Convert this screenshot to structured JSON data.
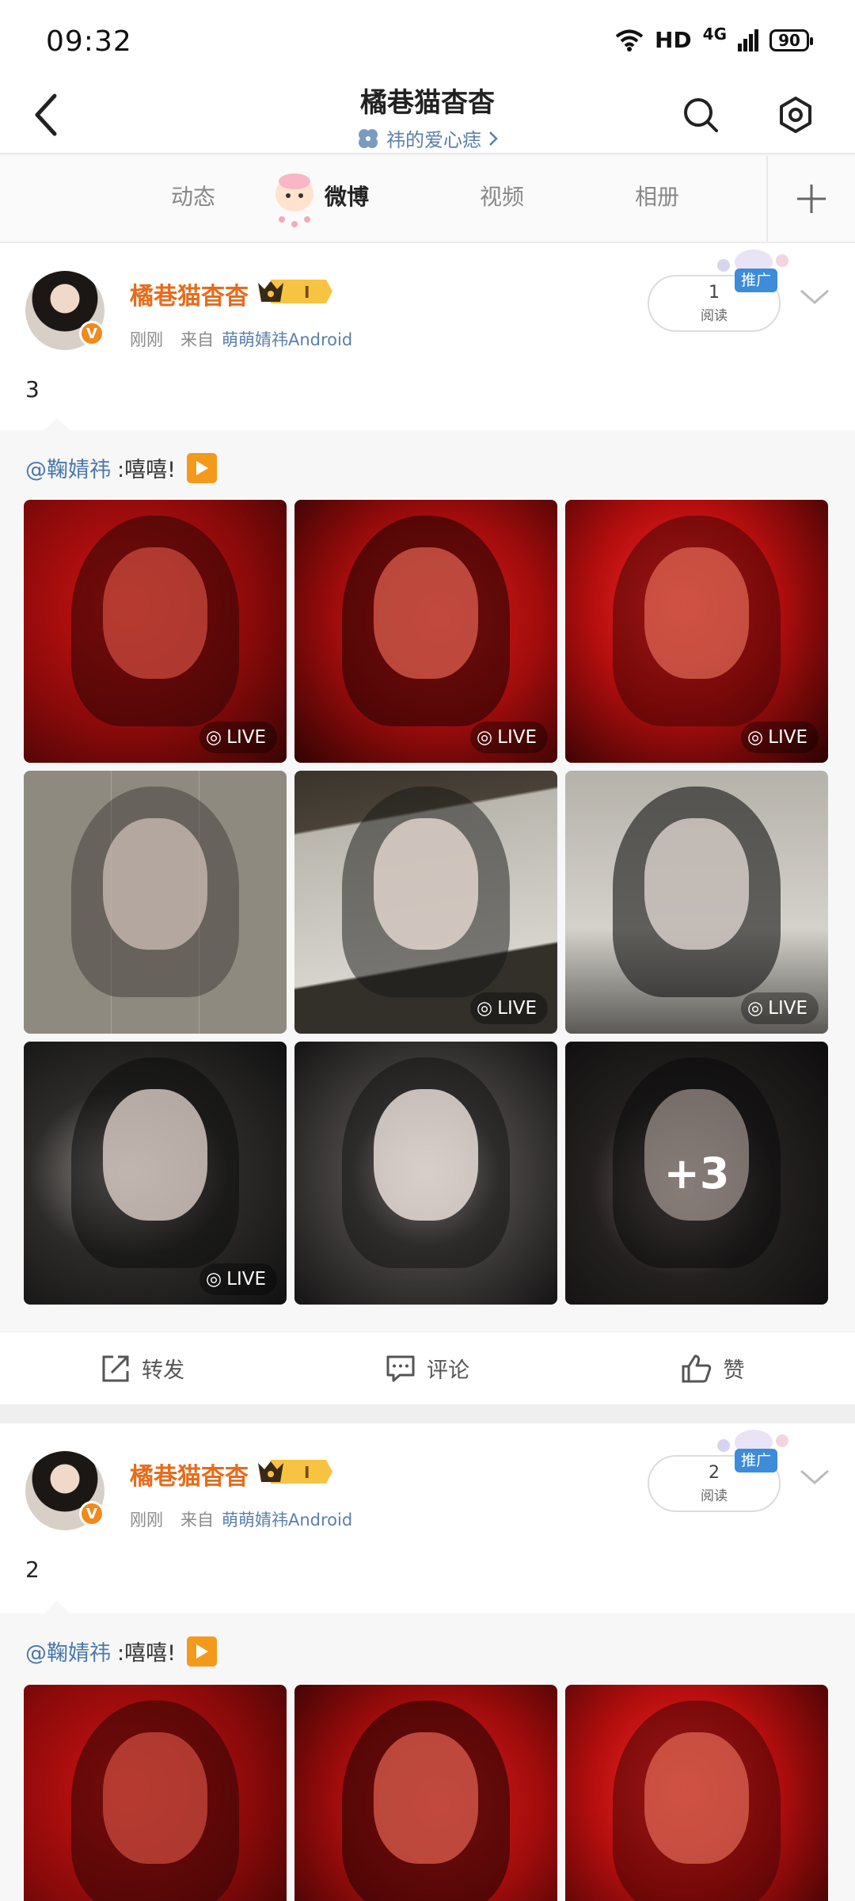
{
  "status": {
    "time": "09:32",
    "network": "HD",
    "signal_type": "4G",
    "battery": "90"
  },
  "header": {
    "title": "橘巷猫杳杳",
    "subtitle": "祎的爱心痣",
    "subtitle_icon": "clover-icon"
  },
  "tabs": [
    {
      "label": "动态",
      "active": false
    },
    {
      "label": "微博",
      "active": true
    },
    {
      "label": "视频",
      "active": false
    },
    {
      "label": "相册",
      "active": false
    }
  ],
  "posts": [
    {
      "username": "橘巷猫杳杳",
      "vip_level": "I",
      "time": "刚刚",
      "from_label": "来自",
      "source": "萌萌婧祎Android",
      "read_count": "1",
      "read_label": "阅读",
      "promo_label": "推广",
      "text": "3",
      "repost": {
        "mention": "@鞠婧祎",
        "text": ":嘻嘻!"
      },
      "photos": [
        {
          "live": true
        },
        {
          "live": true
        },
        {
          "live": true
        },
        {
          "live": false
        },
        {
          "live": true
        },
        {
          "live": true
        },
        {
          "live": true
        },
        {
          "live": false
        },
        {
          "live": false,
          "more": "+3"
        }
      ],
      "live_label": "LIVE",
      "actions": {
        "repost": "转发",
        "comment": "评论",
        "like": "赞"
      }
    },
    {
      "username": "橘巷猫杳杳",
      "vip_level": "I",
      "time": "刚刚",
      "from_label": "来自",
      "source": "萌萌婧祎Android",
      "read_count": "2",
      "read_label": "阅读",
      "promo_label": "推广",
      "text": "2",
      "repost": {
        "mention": "@鞠婧祎",
        "text": ":嘻嘻!"
      }
    }
  ],
  "colors": {
    "username": "#e86b1b",
    "link": "#4a78aa",
    "promo": "#3d8bd9",
    "verify": "#f08a1d"
  }
}
